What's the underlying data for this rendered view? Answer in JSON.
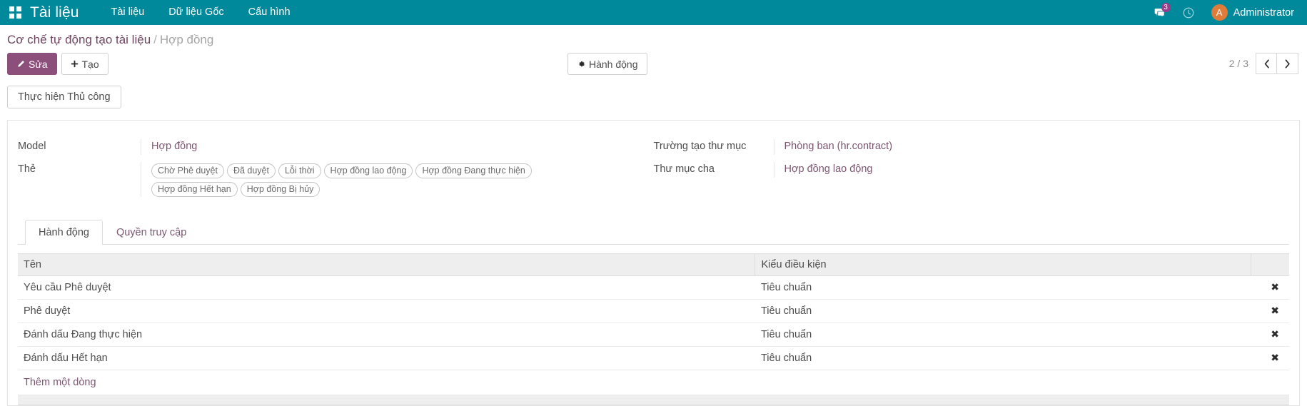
{
  "navbar": {
    "apps_icon": "apps-grid-icon",
    "brand": "Tài liệu",
    "menu": [
      {
        "label": "Tài liệu"
      },
      {
        "label": "Dữ liệu Gốc"
      },
      {
        "label": "Cấu hình"
      }
    ],
    "messages_icon": "chat-bubble-icon",
    "messages_count": "3",
    "activity_icon": "clock-icon",
    "avatar_initial": "A",
    "user_name": "Administrator",
    "bg_color": "#00899B",
    "badge_color": "#9B3D8C",
    "avatar_color": "#E07B39"
  },
  "breadcrumb": {
    "root": "Cơ chế tự động tạo tài liệu",
    "separator": "/",
    "current": "Hợp đồng"
  },
  "controls": {
    "edit_label": "Sửa",
    "edit_icon": "pencil-icon",
    "create_label": "Tạo",
    "create_icon": "plus-icon",
    "action_label": "Hành động",
    "action_icon": "gear-icon",
    "pager_value": "2 / 3",
    "prev_icon": "chevron-left-icon",
    "next_icon": "chevron-right-icon",
    "primary_color": "#8C4F7C"
  },
  "statusbar": {
    "manual_run_label": "Thực hiện Thủ công"
  },
  "form": {
    "left": [
      {
        "label": "Model",
        "type": "link",
        "value": "Hợp đồng"
      },
      {
        "label": "Thẻ",
        "type": "tags",
        "tags": [
          "Chờ Phê duyệt",
          "Đã duyệt",
          "Lỗi thời",
          "Hợp đồng lao động",
          "Hợp đồng Đang thực hiện",
          "Hợp đồng Hết hạn",
          "Hợp đồng Bị hủy"
        ]
      }
    ],
    "right": [
      {
        "label": "Trường tạo thư mục",
        "type": "link",
        "value": "Phòng ban (hr.contract)"
      },
      {
        "label": "Thư mục cha",
        "type": "link",
        "value": "Hợp đồng lao động"
      }
    ]
  },
  "notebook": {
    "tabs": [
      {
        "label": "Hành động",
        "active": true
      },
      {
        "label": "Quyền truy cập",
        "active": false
      }
    ]
  },
  "list": {
    "columns": [
      "Tên",
      "Kiểu điều kiện"
    ],
    "rows": [
      {
        "name": "Yêu cầu Phê duyệt",
        "condition_type": "Tiêu chuẩn",
        "delete_icon": "remove-x-icon"
      },
      {
        "name": "Phê duyệt",
        "condition_type": "Tiêu chuẩn",
        "delete_icon": "remove-x-icon"
      },
      {
        "name": "Đánh dấu Đang thực hiện",
        "condition_type": "Tiêu chuẩn",
        "delete_icon": "remove-x-icon"
      },
      {
        "name": "Đánh dấu Hết hạn",
        "condition_type": "Tiêu chuẩn",
        "delete_icon": "remove-x-icon"
      }
    ],
    "add_row_label": "Thêm một dòng"
  }
}
